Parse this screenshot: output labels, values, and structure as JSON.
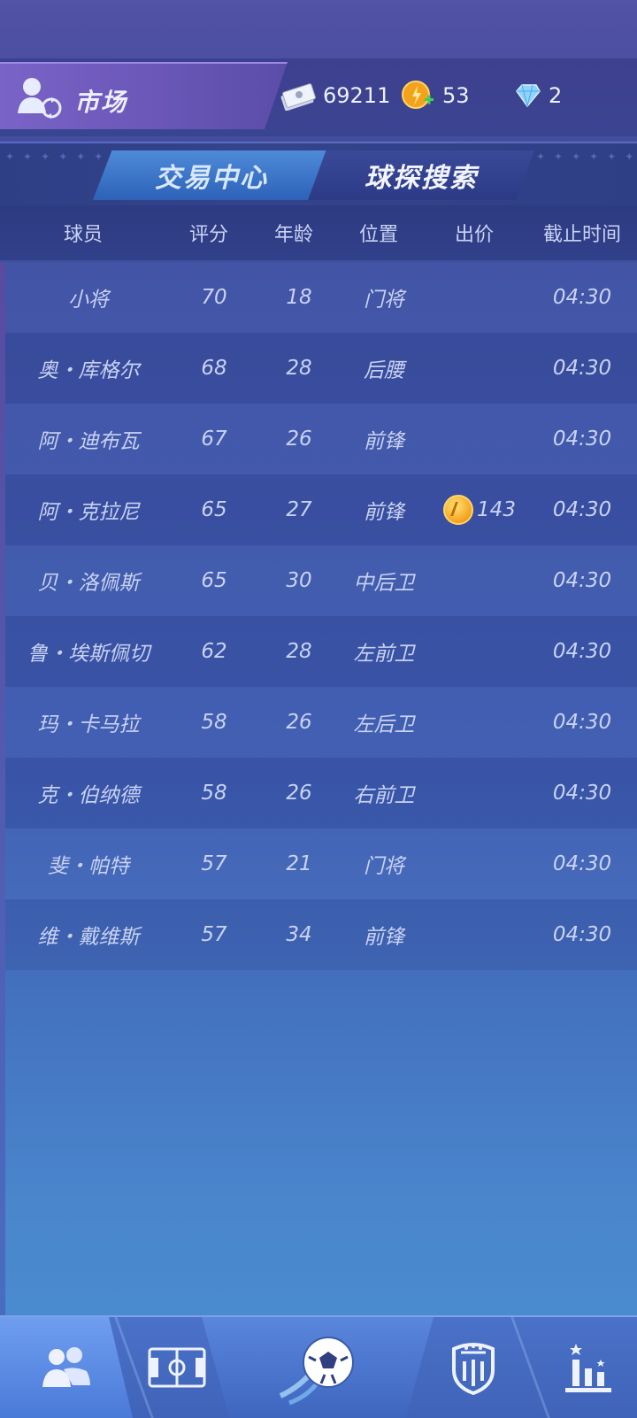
{
  "header": {
    "title": "市场",
    "resources": {
      "cash": "69211",
      "coins": "53",
      "diamonds": "2"
    }
  },
  "tabs": [
    {
      "label": "交易中心",
      "active": true
    },
    {
      "label": "球探搜索",
      "active": false
    }
  ],
  "table": {
    "columns": [
      "球员",
      "评分",
      "年龄",
      "位置",
      "出价",
      "截止时间"
    ],
    "rows": [
      {
        "player": "小将",
        "rating": "70",
        "age": "18",
        "position": "门将",
        "bid": "",
        "deadline": "04:30"
      },
      {
        "player": "奥・库格尔",
        "rating": "68",
        "age": "28",
        "position": "后腰",
        "bid": "",
        "deadline": "04:30"
      },
      {
        "player": "阿・迪布瓦",
        "rating": "67",
        "age": "26",
        "position": "前锋",
        "bid": "",
        "deadline": "04:30"
      },
      {
        "player": "阿・克拉尼",
        "rating": "65",
        "age": "27",
        "position": "前锋",
        "bid": "143",
        "deadline": "04:30"
      },
      {
        "player": "贝・洛佩斯",
        "rating": "65",
        "age": "30",
        "position": "中后卫",
        "bid": "",
        "deadline": "04:30"
      },
      {
        "player": "鲁・埃斯佩切",
        "rating": "62",
        "age": "28",
        "position": "左前卫",
        "bid": "",
        "deadline": "04:30"
      },
      {
        "player": "玛・卡马拉",
        "rating": "58",
        "age": "26",
        "position": "左后卫",
        "bid": "",
        "deadline": "04:30"
      },
      {
        "player": "克・伯纳德",
        "rating": "58",
        "age": "26",
        "position": "右前卫",
        "bid": "",
        "deadline": "04:30"
      },
      {
        "player": "斐・帕特",
        "rating": "57",
        "age": "21",
        "position": "门将",
        "bid": "",
        "deadline": "04:30"
      },
      {
        "player": "维・戴维斯",
        "rating": "57",
        "age": "34",
        "position": "前锋",
        "bid": "",
        "deadline": "04:30"
      }
    ]
  },
  "nav": [
    {
      "icon": "players-icon",
      "active": true
    },
    {
      "icon": "pitch-icon",
      "active": false
    },
    {
      "icon": "football-icon",
      "active": false
    },
    {
      "icon": "club-badge-icon",
      "active": false
    },
    {
      "icon": "ranking-icon",
      "active": false
    }
  ],
  "colors": {
    "accent": "#4f8ad8",
    "coin": "#f3a21b"
  }
}
